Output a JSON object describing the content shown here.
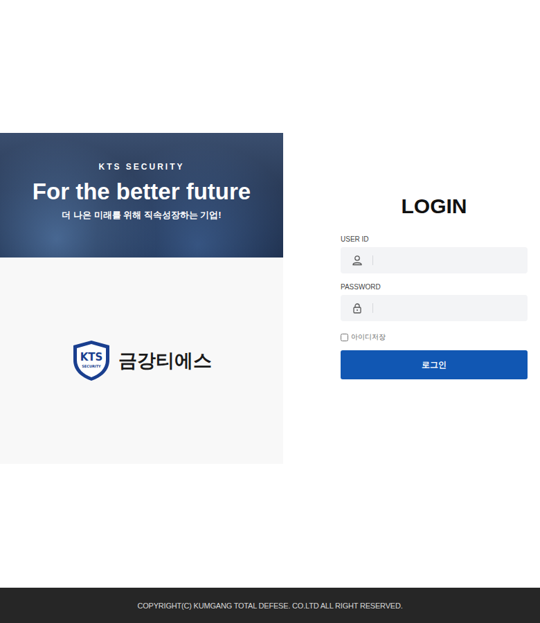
{
  "banner": {
    "eyebrow": "KTS SECURITY",
    "headline": "For the better future",
    "tagline": "더 나은 미래를 위해 직속성장하는 기업!"
  },
  "logo": {
    "badge": "KTS",
    "badge_sub": "SECURITY",
    "name": "금강티에스"
  },
  "login": {
    "title": "LOGIN",
    "fields": [
      {
        "label": "USER ID",
        "kind": "text",
        "value": ""
      },
      {
        "label": "PASSWORD",
        "kind": "password",
        "value": ""
      }
    ],
    "remember": {
      "label": "아이디저장",
      "checked": false
    },
    "button": "로그인"
  },
  "footer": {
    "copyright": "COPYRIGHT(C) KUMGANG TOTAL DEFESE. CO.LTD ALL RIGHT RESERVED."
  }
}
